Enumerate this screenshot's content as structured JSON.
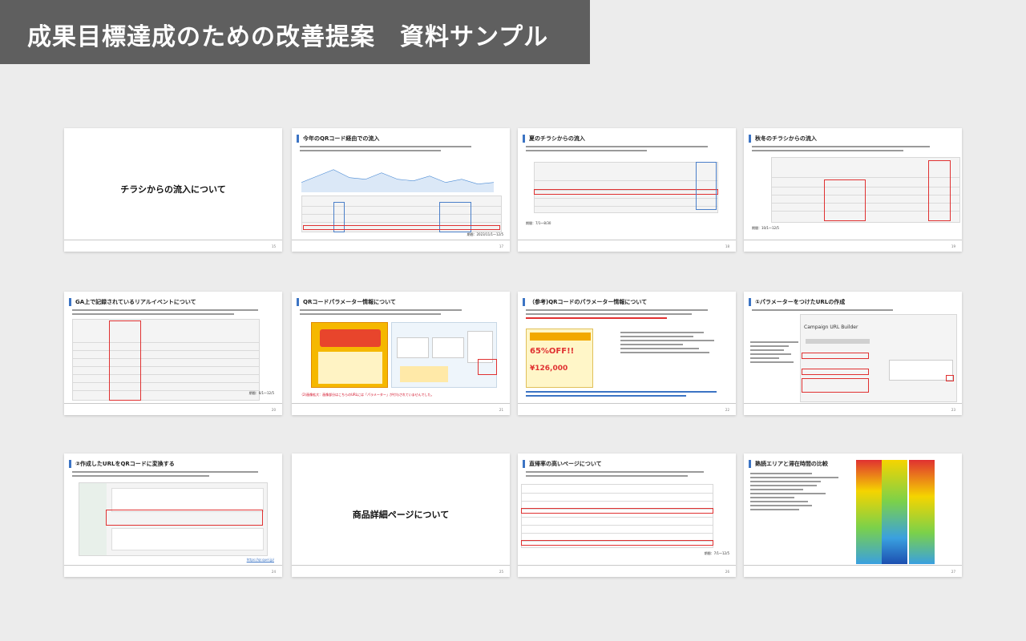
{
  "banner": {
    "title": "成果目標達成のための改善提案　資料サンプル"
  },
  "slides": [
    {
      "title": "チラシからの流入について",
      "page": "15"
    },
    {
      "title": "今年のQRコード経由での流入",
      "page": "17",
      "note": "期間：2023/11/1〜12/5"
    },
    {
      "title": "夏のチラシからの流入",
      "page": "18",
      "note": "期間：7/1〜8/30"
    },
    {
      "title": "秋冬のチラシからの流入",
      "page": "19",
      "note": "期間：10/1〜12/5"
    },
    {
      "title": "GA上で記録されているリアルイベントについて",
      "page": "20",
      "note": "期間：6/1〜12/5"
    },
    {
      "title": "QRコードパラメーター情報について",
      "page": "21",
      "note": "（2)画像拡大：画像部分はこちらのURLには「パラメーター」が付与されていませんでした。"
    },
    {
      "title": "（参考)QRコードのパラメーター情報について",
      "page": "22",
      "sale": "65%OFF!!",
      "price": "¥126,000"
    },
    {
      "title": "①パラメーターをつけたURLの作成",
      "page": "23",
      "tool": "Campaign URL Builder"
    },
    {
      "title": "②作成したURLをQRコードに変換する",
      "page": "24",
      "link": "https://qr.quel.jp/"
    },
    {
      "title": "商品詳細ページについて",
      "page": "25"
    },
    {
      "title": "直帰率の高いページについて",
      "page": "26",
      "note": "期間：7/1〜12/5"
    },
    {
      "title": "熟読エリアと滞在時間の比較",
      "page": "27"
    }
  ]
}
